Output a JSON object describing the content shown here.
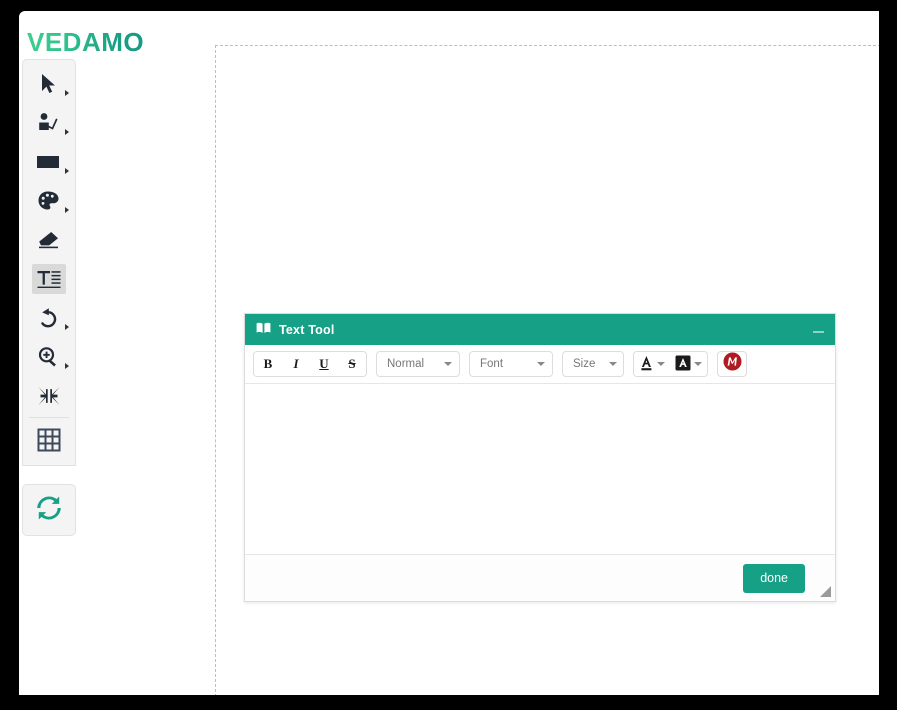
{
  "brand": {
    "logo_text": "VEDAMO"
  },
  "toolbar": {
    "items": [
      {
        "name": "select-tool",
        "icon": "cursor-arrow-icon",
        "has_submenu": true,
        "active": false
      },
      {
        "name": "pointer-tool",
        "icon": "presenter-pointer-icon",
        "has_submenu": true,
        "active": false
      },
      {
        "name": "shape-tool",
        "icon": "rectangle-icon",
        "has_submenu": true,
        "active": false
      },
      {
        "name": "color-tool",
        "icon": "palette-icon",
        "has_submenu": true,
        "active": false
      },
      {
        "name": "eraser-tool",
        "icon": "eraser-icon",
        "has_submenu": false,
        "active": false
      },
      {
        "name": "text-tool",
        "icon": "text-format-icon",
        "has_submenu": false,
        "active": true
      },
      {
        "name": "undo-tool",
        "icon": "undo-arrow-icon",
        "has_submenu": true,
        "active": false
      },
      {
        "name": "zoom-tool",
        "icon": "magnifier-plus-icon",
        "has_submenu": true,
        "active": false
      },
      {
        "name": "collapse-tool",
        "icon": "collapse-arrows-icon",
        "has_submenu": false,
        "active": false
      },
      {
        "name": "grid-tool",
        "icon": "grid-icon",
        "has_submenu": false,
        "active": false
      }
    ],
    "refresh": {
      "name": "refresh-tool",
      "icon": "refresh-sync-icon"
    }
  },
  "dialog": {
    "title": "Text Tool",
    "title_icon": "open-book-icon",
    "minimize_label": "–",
    "format_bar": {
      "bold_label": "B",
      "italic_label": "I",
      "underline_label": "U",
      "strikethrough_label": "S",
      "style_value": "Normal",
      "font_value": "Font",
      "size_value": "Size",
      "font_color_label": "A",
      "highlight_color_label": "A",
      "mathtype_label": "M"
    },
    "editor": {
      "value": "",
      "placeholder": ""
    },
    "footer": {
      "done_label": "done"
    }
  },
  "colors": {
    "brand_green": "#16a085",
    "logo_gradient_start": "#3ecf8e",
    "logo_gradient_end": "#169b82",
    "mathtype_red": "#b01b23",
    "icon_dark": "#2b3440",
    "toolbar_bg": "#f4f4f4",
    "page_frame": "#000000"
  }
}
